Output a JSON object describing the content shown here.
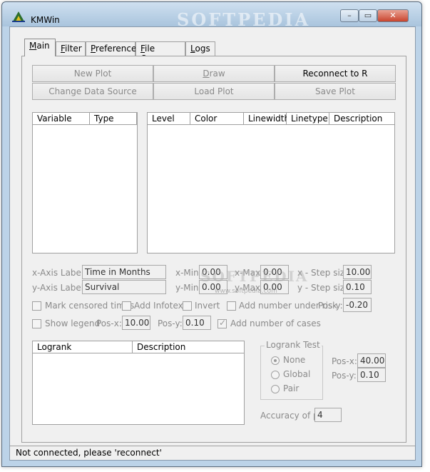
{
  "window": {
    "title": "KMWin",
    "watermark": "SOFTPEDIA",
    "center_watermark": "SOFTPEDIA",
    "center_watermark_url": "www.softpedia.com",
    "minimize_glyph": "–",
    "maximize_glyph": "▭",
    "close_glyph": "✕"
  },
  "tabs": [
    {
      "label": "Main",
      "underline": "M",
      "rest": "ain",
      "active": true
    },
    {
      "label": "Filter",
      "underline": "F",
      "rest": "ilter",
      "active": false
    },
    {
      "label": "Preferences",
      "underline": "P",
      "rest": "references",
      "active": false
    },
    {
      "label": "File Queue",
      "underline": "F",
      "rest": "ile Queue",
      "active": false
    },
    {
      "label": "Logs",
      "underline": "L",
      "rest": "ogs",
      "active": false
    }
  ],
  "buttons": {
    "new_plot": "New Plot",
    "draw_u": "D",
    "draw_rest": "raw",
    "reconnect": "Reconnect to R",
    "change_data_source": "Change Data Source",
    "load_plot": "Load Plot",
    "save_plot": "Save Plot"
  },
  "variable_list": {
    "columns": [
      "Variable",
      "Type"
    ]
  },
  "level_list": {
    "columns": [
      "Level",
      "Color",
      "Linewidth",
      "Linetype",
      "Description"
    ]
  },
  "axis": {
    "x_label_caption": "x-Axis Label:",
    "x_label_value": "Time in Months",
    "y_label_caption": "y-Axis Label:",
    "y_label_value": "Survival",
    "x_min_caption": "x-Min:",
    "x_min_value": "0.00",
    "x_max_caption": "x-Max:",
    "x_max_value": "0.00",
    "x_step_caption": "x - Step size:",
    "x_step_value": "10.00",
    "y_min_caption": "y-Min:",
    "y_min_value": "0.00",
    "y_max_caption": "y-Max:",
    "y_max_value": "0.00",
    "y_step_caption": "y - Step size:",
    "y_step_value": "0.10"
  },
  "options": {
    "mark_censored": "Mark censored times",
    "add_infotext": "Add Infotext",
    "invert": "Invert",
    "add_number_at_risk": "Add number under risk",
    "risk_pos_y_caption": "Pos-y:",
    "risk_pos_y_value": "-0.20",
    "show_legend": "Show legend",
    "legend_pos_x_caption": "Pos-x:",
    "legend_pos_x_value": "10.00",
    "legend_pos_y_caption": "Pos-y:",
    "legend_pos_y_value": "0.10",
    "add_number_of_cases": "Add number of cases",
    "add_number_of_cases_checked": true
  },
  "logrank_list": {
    "columns": [
      "Logrank",
      "Description"
    ]
  },
  "logrank_test": {
    "title": "Logrank Test",
    "options": [
      "None",
      "Global",
      "Pair"
    ],
    "selected": "None",
    "pos_x_caption": "Pos-x:",
    "pos_x_value": "40.00",
    "pos_y_caption": "Pos-y:",
    "pos_y_value": "0.10",
    "accuracy_caption": "Accuracy of p:",
    "accuracy_value": "4"
  },
  "status": {
    "text": "Not connected, please 'reconnect'"
  }
}
